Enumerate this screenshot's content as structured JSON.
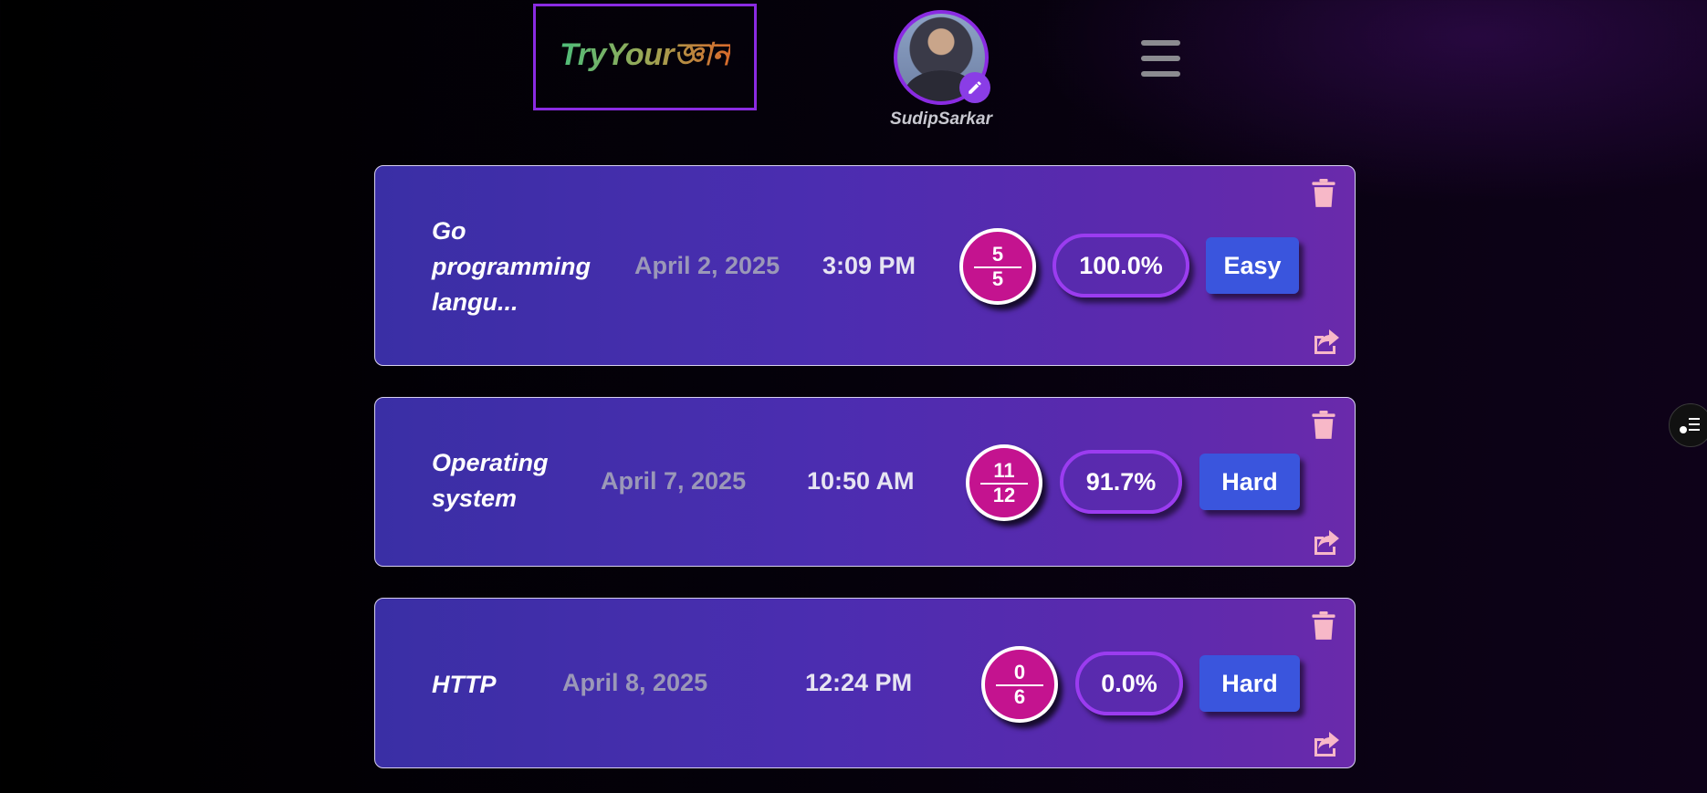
{
  "header": {
    "logo_text": "TryYourজ্ঞান",
    "username": "SudipSarkar",
    "avatar_icon": "user-avatar",
    "edit_icon": "pencil-icon",
    "menu_icon": "hamburger-icon"
  },
  "quizzes": [
    {
      "title_lines": [
        "Go",
        "programming",
        "langu..."
      ],
      "date": "April 2, 2025",
      "time": "3:09 PM",
      "score_num": "5",
      "score_den": "5",
      "percent": "100.0%",
      "difficulty": "Easy"
    },
    {
      "title_lines": [
        "Operating",
        "system"
      ],
      "date": "April 7, 2025",
      "time": "10:50 AM",
      "score_num": "11",
      "score_den": "12",
      "percent": "91.7%",
      "difficulty": "Hard"
    },
    {
      "title_lines": [
        "HTTP"
      ],
      "date": "April 8, 2025",
      "time": "12:24 PM",
      "score_num": "0",
      "score_den": "6",
      "percent": "0.0%",
      "difficulty": "Hard"
    }
  ],
  "colors": {
    "accent": "#8a2be2",
    "score_circle": "#c4138f",
    "difficulty_button": "#3a55dd",
    "icon_pink": "#f7b8c8"
  }
}
